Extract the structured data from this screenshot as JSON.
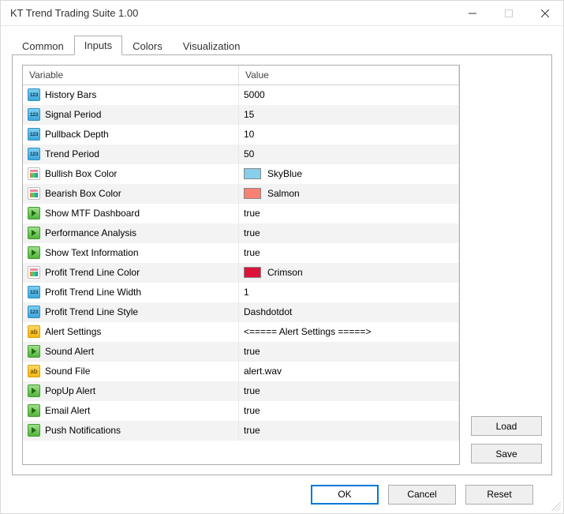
{
  "window": {
    "title": "KT Trend Trading Suite 1.00"
  },
  "tabs": [
    {
      "label": "Common",
      "active": false
    },
    {
      "label": "Inputs",
      "active": true
    },
    {
      "label": "Colors",
      "active": false
    },
    {
      "label": "Visualization",
      "active": false
    }
  ],
  "columns": {
    "variable": "Variable",
    "value": "Value"
  },
  "rows": [
    {
      "icon": "int",
      "name": "History Bars",
      "value": "5000"
    },
    {
      "icon": "int",
      "name": "Signal Period",
      "value": "15"
    },
    {
      "icon": "int",
      "name": "Pullback Depth",
      "value": "10"
    },
    {
      "icon": "int",
      "name": "Trend Period",
      "value": "50"
    },
    {
      "icon": "color",
      "name": "Bullish Box Color",
      "value": "SkyBlue",
      "swatch": "#87CEEB"
    },
    {
      "icon": "color",
      "name": "Bearish Box Color",
      "value": "Salmon",
      "swatch": "#FA8072"
    },
    {
      "icon": "bool",
      "name": "Show MTF Dashboard",
      "value": "true"
    },
    {
      "icon": "bool",
      "name": "Performance Analysis",
      "value": "true"
    },
    {
      "icon": "bool",
      "name": "Show Text Information",
      "value": "true"
    },
    {
      "icon": "color",
      "name": "Profit Trend Line Color",
      "value": "Crimson",
      "swatch": "#DC143C"
    },
    {
      "icon": "int",
      "name": "Profit Trend Line Width",
      "value": "1"
    },
    {
      "icon": "int",
      "name": "Profit Trend Line Style",
      "value": "Dashdotdot"
    },
    {
      "icon": "str",
      "name": "Alert Settings",
      "value": "<===== Alert Settings =====>"
    },
    {
      "icon": "bool",
      "name": "Sound Alert",
      "value": "true"
    },
    {
      "icon": "str",
      "name": "Sound File",
      "value": "alert.wav"
    },
    {
      "icon": "bool",
      "name": "PopUp Alert",
      "value": "true"
    },
    {
      "icon": "bool",
      "name": "Email Alert",
      "value": "true"
    },
    {
      "icon": "bool",
      "name": "Push Notifications",
      "value": "true"
    }
  ],
  "buttons": {
    "load": "Load",
    "save": "Save",
    "ok": "OK",
    "cancel": "Cancel",
    "reset": "Reset"
  }
}
